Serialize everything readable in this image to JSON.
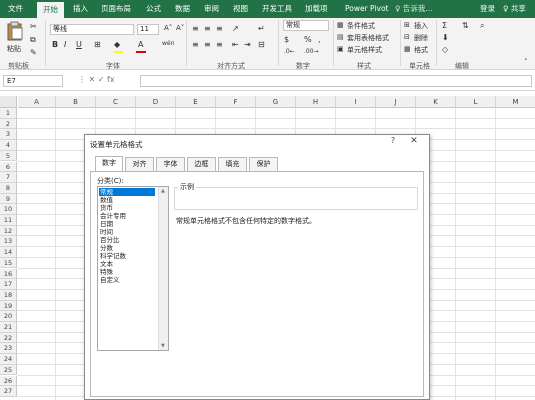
{
  "ribbon_tabs": [
    "文件",
    "开始",
    "插入",
    "页面布局",
    "公式",
    "数据",
    "审阅",
    "视图",
    "开发工具",
    "加载项",
    "Power Pivot"
  ],
  "active_tab": "开始",
  "tell_me": "♀ 告诉我...",
  "login": "登录",
  "share": "♀ 共享",
  "ribbon": {
    "paste": "粘贴",
    "font_name": "等线",
    "font_size": "11",
    "number_format": "常规",
    "cond_format": "条件格式",
    "table_format": "套用表格格式",
    "cell_style": "单元格样式",
    "insert": "插入",
    "delete": "删除",
    "format": "格式",
    "groups": {
      "clipboard": "剪贴板",
      "font": "字体",
      "alignment": "对齐方式",
      "number": "数字",
      "style": "样式",
      "cells": "单元格",
      "edit": "编辑"
    },
    "bold": "B",
    "italic": "I",
    "underline": "U"
  },
  "formula_bar": {
    "name_box": "E7",
    "icons": "⋮  ✕  ✓  fx"
  },
  "columns": [
    "A",
    "B",
    "C",
    "D",
    "E",
    "F",
    "G",
    "H",
    "I",
    "J",
    "K",
    "L",
    "M"
  ],
  "rows": [
    "1",
    "2",
    "3",
    "4",
    "5",
    "6",
    "7",
    "8",
    "9",
    "10",
    "11",
    "12",
    "13",
    "14",
    "15",
    "16",
    "17",
    "18",
    "19",
    "20",
    "21",
    "22",
    "23",
    "24",
    "25",
    "26",
    "27"
  ],
  "dialog": {
    "title": "设置单元格格式",
    "help": "?",
    "close": "✕",
    "tabs": [
      "数字",
      "对齐",
      "字体",
      "边框",
      "填充",
      "保护"
    ],
    "category_label": "分类(C):",
    "categories": [
      "常规",
      "数值",
      "货币",
      "会计专用",
      "日期",
      "时间",
      "百分比",
      "分数",
      "科学记数",
      "文本",
      "特殊",
      "自定义"
    ],
    "selected_category": "常规",
    "sample_label": "示例",
    "description": "常规单元格格式不包含任何特定的数字格式。"
  },
  "colors": {
    "ribbon_green": "#217346",
    "selection_blue": "#0078d7"
  }
}
